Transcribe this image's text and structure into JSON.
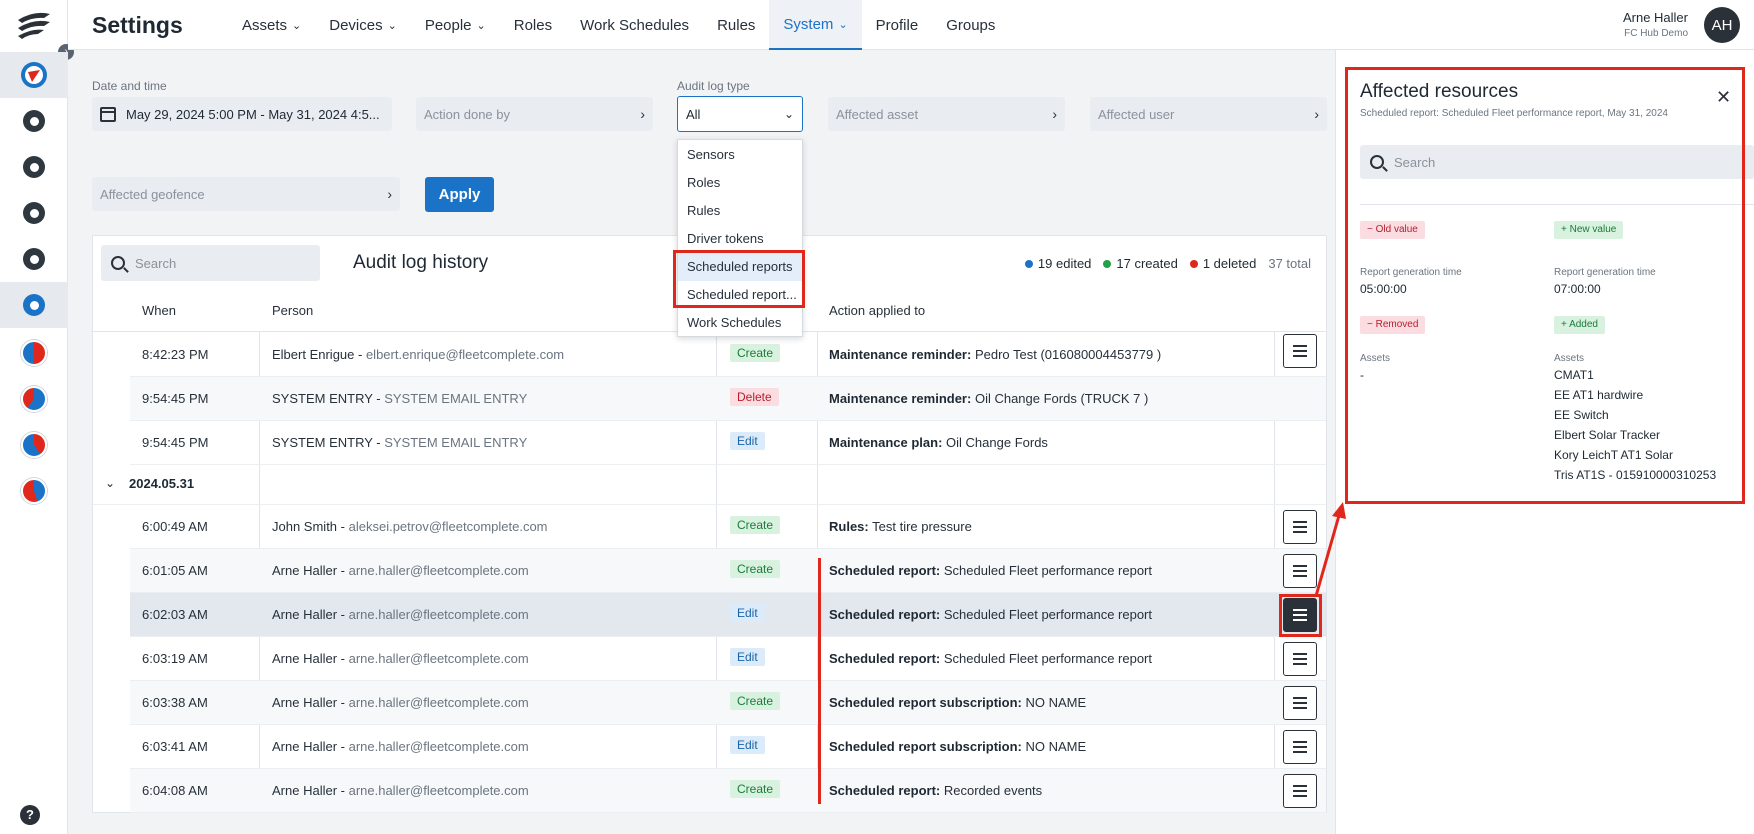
{
  "app": {
    "title": "Settings"
  },
  "nav": [
    {
      "label": "Assets",
      "dropdown": true
    },
    {
      "label": "Devices",
      "dropdown": true
    },
    {
      "label": "People",
      "dropdown": true
    },
    {
      "label": "Roles",
      "dropdown": false
    },
    {
      "label": "Work Schedules",
      "dropdown": false
    },
    {
      "label": "Rules",
      "dropdown": false
    },
    {
      "label": "System",
      "dropdown": true,
      "active": true
    },
    {
      "label": "Profile",
      "dropdown": false
    },
    {
      "label": "Groups",
      "dropdown": false
    }
  ],
  "user": {
    "name": "Arne Haller",
    "company": "FC Hub Demo",
    "initials": "AH"
  },
  "filters": {
    "date_label": "Date and time",
    "date_value": "May 29, 2024 5:00 PM - May 31, 2024 4:5...",
    "action_by_placeholder": "Action done by",
    "type_label": "Audit log type",
    "type_value": "All",
    "affected_asset_placeholder": "Affected asset",
    "affected_user_placeholder": "Affected user",
    "affected_geofence_placeholder": "Affected geofence",
    "apply_label": "Apply"
  },
  "dropdown": {
    "options": [
      "Sensors",
      "Roles",
      "Rules",
      "Driver tokens",
      "Scheduled reports",
      "Scheduled report...",
      "Work Schedules"
    ],
    "highlighted": "Scheduled reports"
  },
  "table": {
    "search_placeholder": "Search",
    "title": "Audit log history",
    "stats": {
      "edited": "19 edited",
      "created": "17 created",
      "deleted": "1 deleted",
      "total": "37 total"
    },
    "columns": {
      "when": "When",
      "person": "Person",
      "action_applied": "Action applied to"
    },
    "group_label": "2024.05.31",
    "rows_before": [
      {
        "time": "8:42:23 PM",
        "name": "Elbert Enrigue",
        "email": "elbert.enrique@fleetcomplete.com",
        "action": "Create",
        "target_type": "Maintenance reminder:",
        "target": "Pedro Test (016080004453779 )"
      },
      {
        "time": "9:54:45 PM",
        "name": "SYSTEM ENTRY",
        "email": "SYSTEM EMAIL ENTRY",
        "action": "Delete",
        "target_type": "Maintenance reminder:",
        "target": "Oil Change Fords (TRUCK 7 )"
      },
      {
        "time": "9:54:45 PM",
        "name": "SYSTEM ENTRY",
        "email": "SYSTEM EMAIL ENTRY",
        "action": "Edit",
        "target_type": "Maintenance plan:",
        "target": "Oil Change Fords"
      }
    ],
    "rows_after": [
      {
        "time": "6:00:49 AM",
        "name": "John Smith",
        "email": "aleksei.petrov@fleetcomplete.com",
        "action": "Create",
        "target_type": "Rules:",
        "target": "Test tire pressure"
      },
      {
        "time": "6:01:05 AM",
        "name": "Arne Haller",
        "email": "arne.haller@fleetcomplete.com",
        "action": "Create",
        "target_type": "Scheduled report:",
        "target": "Scheduled Fleet performance report"
      },
      {
        "time": "6:02:03 AM",
        "name": "Arne Haller",
        "email": "arne.haller@fleetcomplete.com",
        "action": "Edit",
        "target_type": "Scheduled report:",
        "target": "Scheduled Fleet performance report"
      },
      {
        "time": "6:03:19 AM",
        "name": "Arne Haller",
        "email": "arne.haller@fleetcomplete.com",
        "action": "Edit",
        "target_type": "Scheduled report:",
        "target": "Scheduled Fleet performance report"
      },
      {
        "time": "6:03:38 AM",
        "name": "Arne Haller",
        "email": "arne.haller@fleetcomplete.com",
        "action": "Create",
        "target_type": "Scheduled report subscription:",
        "target": "NO NAME"
      },
      {
        "time": "6:03:41 AM",
        "name": "Arne Haller",
        "email": "arne.haller@fleetcomplete.com",
        "action": "Edit",
        "target_type": "Scheduled report subscription:",
        "target": "NO NAME"
      },
      {
        "time": "6:04:08 AM",
        "name": "Arne Haller",
        "email": "arne.haller@fleetcomplete.com",
        "action": "Create",
        "target_type": "Scheduled report:",
        "target": "Recorded events"
      }
    ]
  },
  "panel": {
    "title": "Affected resources",
    "subtitle": "Scheduled report: Scheduled Fleet performance report, May 31, 2024",
    "search_placeholder": "Search",
    "old_tag": "Old value",
    "new_tag": "New value",
    "old_label": "Report generation time",
    "old_value": "05:00:00",
    "new_label": "Report generation time",
    "new_value": "07:00:00",
    "removed_tag": "Removed",
    "added_tag": "Added",
    "removed_label": "Assets",
    "removed_value": "-",
    "added_label": "Assets",
    "added_values": [
      "CMAT1",
      "EE AT1 hardwire",
      "EE Switch",
      "Elbert Solar Tracker",
      "Kory LeichT AT1 Solar",
      "Tris AT1S - 015910000310253"
    ]
  },
  "colors": {
    "accent": "#1b73c7",
    "annotation": "#e0271b",
    "create": "#1c7a3a",
    "delete": "#b71c2d",
    "edited_dot": "#1b73c7",
    "created_dot": "#22a04a",
    "deleted_dot": "#e0271b"
  },
  "icons": {
    "rail": [
      "fleet-complete-logo",
      "expand-chevron-icon",
      "app-switch-icon",
      "dashboard-icon",
      "map-pin-icon",
      "document-icon",
      "wrench-icon",
      "settings-gear-icon",
      "app-icon-1",
      "app-icon-2",
      "app-icon-3",
      "app-icon-4",
      "help-icon"
    ]
  }
}
